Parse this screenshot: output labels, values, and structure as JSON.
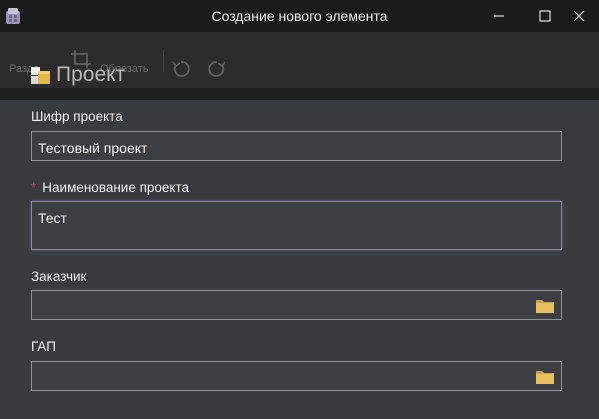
{
  "window": {
    "title": "Создание нового элемента"
  },
  "toolbar": {
    "razdel_label": "Разде",
    "crop_label": "Обрезать",
    "undo_icon": "undo-icon",
    "redo_icon": "redo-icon"
  },
  "header": {
    "title": "Проект",
    "icon": "project-icon"
  },
  "form": {
    "fields": [
      {
        "label": "Шифр проекта",
        "value": "Тестовый проект",
        "required": false
      },
      {
        "label": "Наименование проекта",
        "value": "Тест",
        "required": true,
        "required_mark": "*"
      },
      {
        "label": "Заказчик",
        "value": "",
        "icon": "folder-icon"
      },
      {
        "label": "ГАП",
        "value": "",
        "icon": "folder-icon"
      }
    ]
  },
  "colors": {
    "background": "#383c40",
    "titlebar": "#1c1c1c",
    "required_mark": "#d23b3b",
    "folder": "#e8c15c"
  }
}
